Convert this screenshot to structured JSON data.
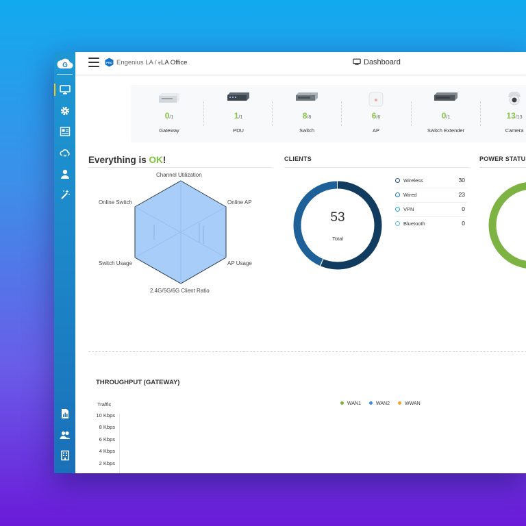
{
  "breadcrumb": {
    "org": "Engenius LA",
    "separator": "/",
    "site_mark": "⩔",
    "site": "LA Office"
  },
  "page": {
    "title": "Dashboard"
  },
  "devices": [
    {
      "count": "0",
      "total": "/1",
      "label": "Gateway"
    },
    {
      "count": "1",
      "total": "/1",
      "label": "PDU"
    },
    {
      "count": "8",
      "total": "/8",
      "label": "Switch"
    },
    {
      "count": "6",
      "total": "/6",
      "label": "AP"
    },
    {
      "count": "0",
      "total": "/1",
      "label": "Switch Extender"
    },
    {
      "count": "13",
      "total": "/13",
      "label": "Camera"
    }
  ],
  "health": {
    "prefix": "Everything is ",
    "status": "OK",
    "suffix": "!",
    "axes": [
      "Channel Utilization",
      "Online AP",
      "AP Usage",
      "2.4G/5G/6G Client Ratio",
      "Switch Usage",
      "Online Switch"
    ]
  },
  "clients": {
    "title": "CLIENTS",
    "total": "53",
    "total_label": "Total",
    "items": [
      {
        "name": "Wireless",
        "value": "30",
        "color": "#0d4a7a"
      },
      {
        "name": "Wired",
        "value": "23",
        "color": "#1677b8"
      },
      {
        "name": "VPN",
        "value": "0",
        "color": "#1fa3d6"
      },
      {
        "name": "Bluetooth",
        "value": "0",
        "color": "#59c1e6"
      }
    ]
  },
  "power": {
    "title": "POWER STATUS"
  },
  "throughput": {
    "title": "THROUGHPUT (GATEWAY)",
    "ylabel": "Traffic",
    "yticks": [
      "10 Kbps",
      "8 Kbps",
      "6 Kbps",
      "4 Kbps",
      "2 Kbps"
    ],
    "series": [
      {
        "name": "WAN1",
        "color": "#7cb342"
      },
      {
        "name": "WAN2",
        "color": "#3d8fdf"
      },
      {
        "name": "WWAN",
        "color": "#f0a431"
      }
    ]
  },
  "colors": {
    "accent_ok": "#7cc142",
    "sidebar": "#1d86c8",
    "donut_primary": "#123c5f",
    "donut_secondary": "#1e6199",
    "radar_fill": "#a7cdf8"
  }
}
